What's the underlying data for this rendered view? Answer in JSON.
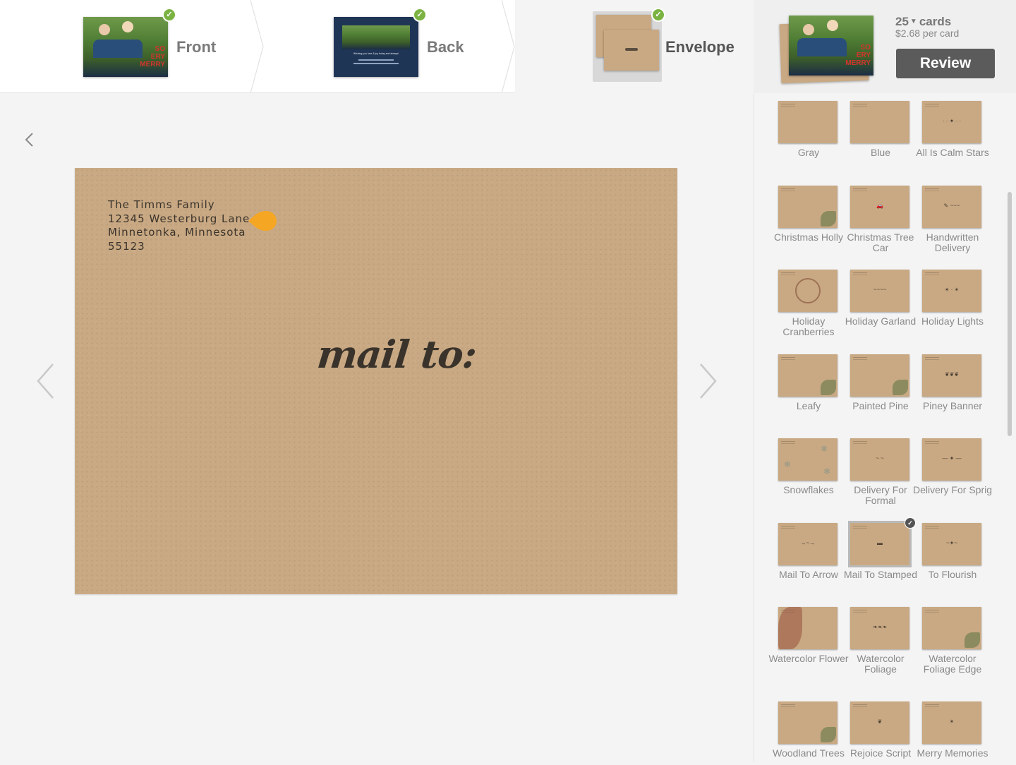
{
  "steps": [
    {
      "label": "Front",
      "done": true
    },
    {
      "label": "Back",
      "done": true
    },
    {
      "label": "Envelope",
      "done": true
    }
  ],
  "summary": {
    "count": "25",
    "count_unit": "cards",
    "price": "$2.68 per card",
    "review_label": "Review"
  },
  "front_card_text": [
    "SO",
    "ERY",
    "MERRY"
  ],
  "back_card_text": "Wishing you love & joy today and always!",
  "envelope": {
    "return_address": [
      "The Timms Family",
      "12345 Westerburg Lane",
      "Minnetonka, Minnesota",
      "55123"
    ],
    "mail_to": "mail to:"
  },
  "options": [
    {
      "label": "Gray"
    },
    {
      "label": "Blue"
    },
    {
      "label": "All Is Calm Stars"
    },
    {
      "label": "Christmas Holly"
    },
    {
      "label": "Christmas Tree Car"
    },
    {
      "label": "Handwritten Delivery"
    },
    {
      "label": "Holiday Cranberries"
    },
    {
      "label": "Holiday Garland"
    },
    {
      "label": "Holiday Lights"
    },
    {
      "label": "Leafy"
    },
    {
      "label": "Painted Pine"
    },
    {
      "label": "Piney Banner"
    },
    {
      "label": "Snowflakes"
    },
    {
      "label": "Delivery For Formal"
    },
    {
      "label": "Delivery For Sprig"
    },
    {
      "label": "Mail To Arrow"
    },
    {
      "label": "Mail To Stamped",
      "selected": true
    },
    {
      "label": "To Flourish"
    },
    {
      "label": "Watercolor Flower"
    },
    {
      "label": "Watercolor Foliage"
    },
    {
      "label": "Watercolor Foliage Edge"
    },
    {
      "label": "Woodland Trees"
    },
    {
      "label": "Rejoice Script"
    },
    {
      "label": "Merry Memories"
    }
  ],
  "colors": {
    "kraft": "#c9a983",
    "check_green": "#7bb342",
    "marker_orange": "#f5a623",
    "review_bg": "#5b5b5b",
    "front_text_red": "#d2352c"
  },
  "icons": {
    "back": "chevron-left-icon",
    "prev": "chevron-left-icon",
    "next": "chevron-right-icon",
    "check": "check-icon",
    "marker": "edit-marker-icon",
    "caret": "caret-down-icon"
  }
}
